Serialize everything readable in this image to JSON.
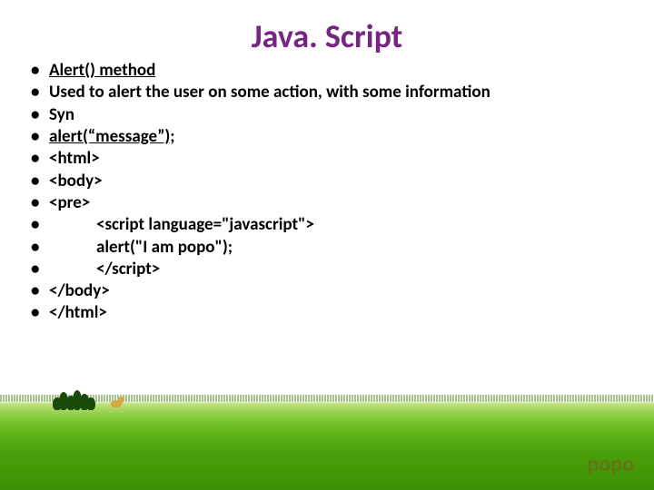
{
  "title": "Java. Script",
  "bullets": [
    {
      "text": "Alert() method",
      "underline": true,
      "indent": false
    },
    {
      "text": "Used to alert the user on some action, with some information",
      "underline": false,
      "indent": false
    },
    {
      "text": "Syn",
      "underline": false,
      "indent": false
    },
    {
      "text": "alert(“message”);",
      "underline": true,
      "indent": false
    },
    {
      "text": "<html>",
      "underline": false,
      "indent": false
    },
    {
      "text": "<body>",
      "underline": false,
      "indent": false
    },
    {
      "text": "<pre>",
      "underline": false,
      "indent": false
    },
    {
      "text": "<script  language=\"javascript\">",
      "underline": false,
      "indent": true
    },
    {
      "text": "alert(\"I am popo\");",
      "underline": false,
      "indent": true
    },
    {
      "text": "</script>",
      "underline": false,
      "indent": true
    },
    {
      "text": "</body>",
      "underline": false,
      "indent": false
    },
    {
      "text": "</html>",
      "underline": false,
      "indent": false
    }
  ],
  "footer": "popo"
}
